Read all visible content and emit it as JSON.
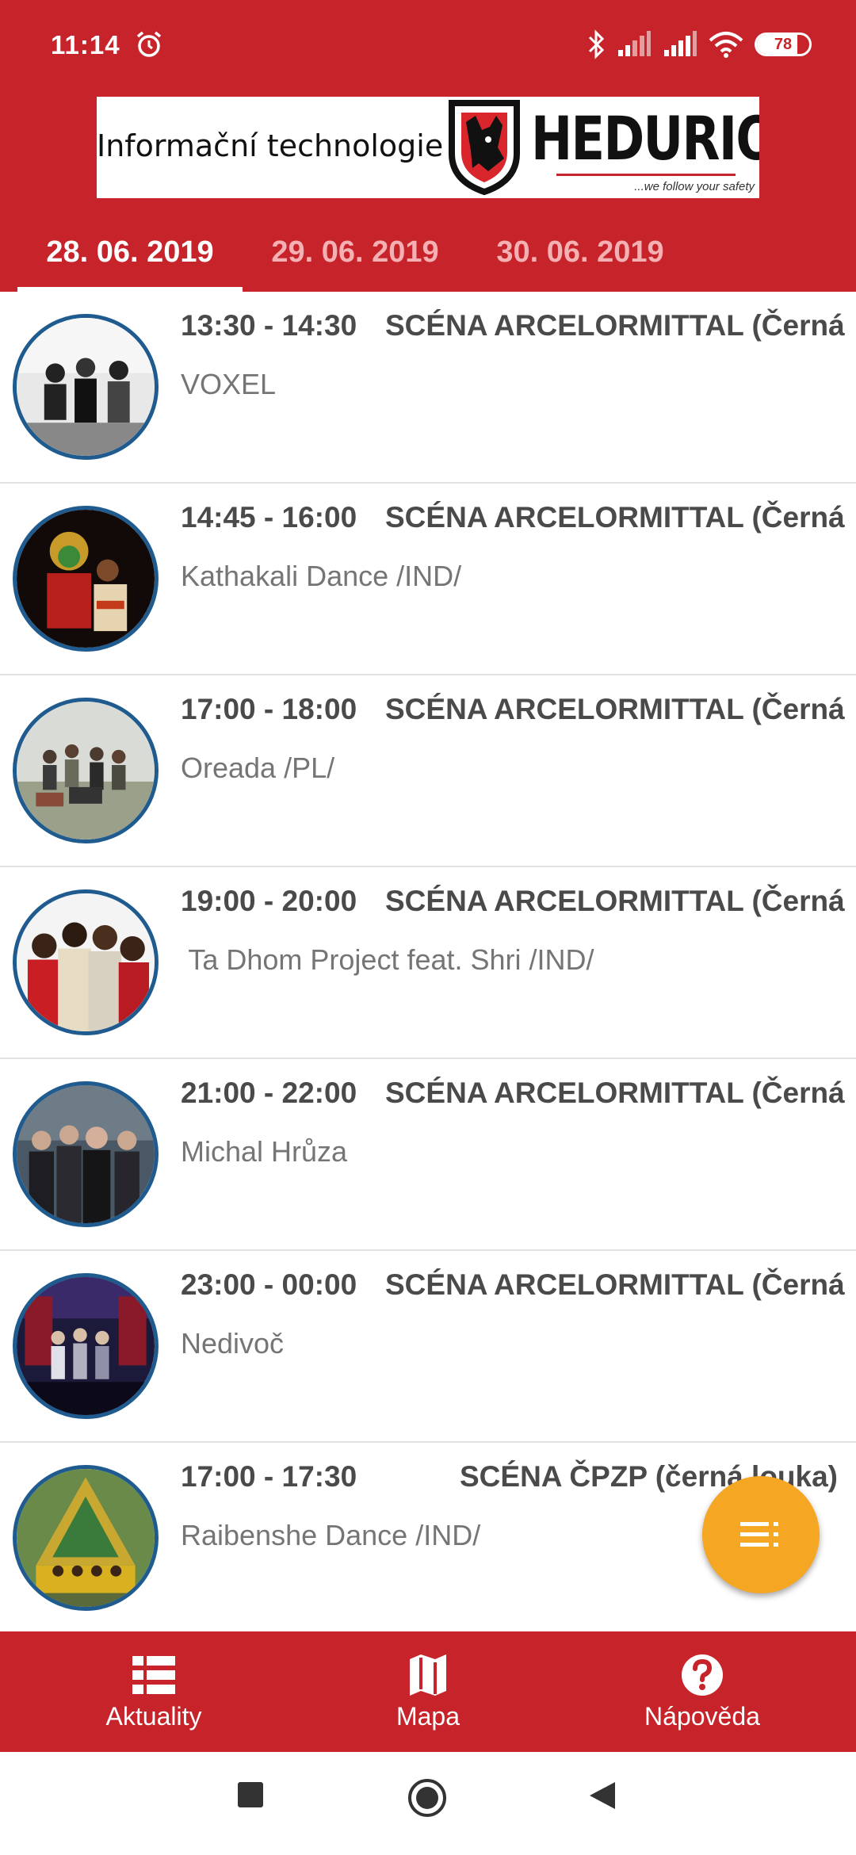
{
  "status_bar": {
    "time": "11:14",
    "battery": "78",
    "battery_level": 0.78
  },
  "banner": {
    "text": "Informační technologie",
    "brand": "HEDURIO",
    "tagline": "...we follow your safety"
  },
  "tabs": [
    {
      "label": "28. 06. 2019",
      "active": true
    },
    {
      "label": "29. 06. 2019",
      "active": false
    },
    {
      "label": "30. 06. 2019",
      "active": false
    }
  ],
  "events": [
    {
      "time": "13:30 - 14:30",
      "stage": "SCÉNA ARCELORMITTAL (Černá",
      "title": "VOXEL"
    },
    {
      "time": "14:45 - 16:00",
      "stage": "SCÉNA ARCELORMITTAL (Černá",
      "title": "Kathakali Dance /IND/"
    },
    {
      "time": "17:00 - 18:00",
      "stage": "SCÉNA ARCELORMITTAL (Černá",
      "title": "Oreada /PL/"
    },
    {
      "time": "19:00 - 20:00",
      "stage": "SCÉNA ARCELORMITTAL (Černá",
      "title": " Ta Dhom Project feat. Shri /IND/"
    },
    {
      "time": "21:00 - 22:00",
      "stage": "SCÉNA ARCELORMITTAL (Černá",
      "title": "Michal Hrůza"
    },
    {
      "time": "23:00 - 00:00",
      "stage": "SCÉNA ARCELORMITTAL (Černá",
      "title": "Nedivoč"
    },
    {
      "time": "17:00 - 17:30",
      "stage": "SCÉNA ČPZP (černá louka)",
      "title": "Raibenshe Dance /IND/"
    }
  ],
  "bottom_nav": [
    {
      "label": "Aktuality",
      "icon": "list-icon"
    },
    {
      "label": "Mapa",
      "icon": "map-icon"
    },
    {
      "label": "Nápověda",
      "icon": "help-icon"
    }
  ],
  "colors": {
    "primary": "#c6242a",
    "fab": "#f5a623",
    "avatar_border": "#1f5b8f"
  }
}
